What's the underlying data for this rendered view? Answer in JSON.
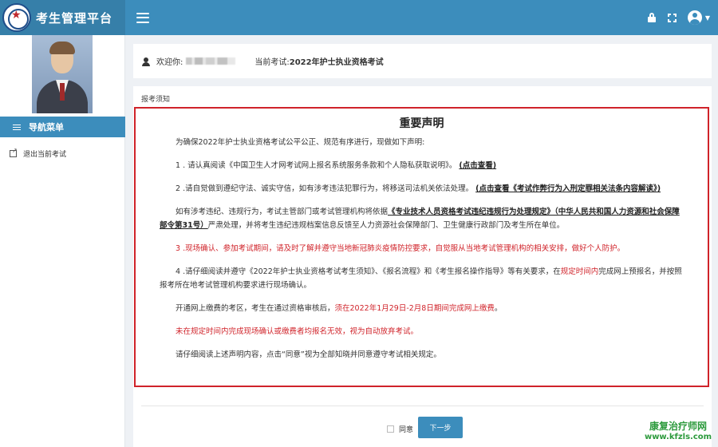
{
  "header": {
    "title": "考生管理平台"
  },
  "sidebar": {
    "menu_title": "导航菜单",
    "items": [
      {
        "label": "退出当前考试"
      }
    ]
  },
  "welcome": {
    "greeting": "欢迎你:",
    "current_exam_label": "当前考试:",
    "current_exam": "2022年护士执业资格考试"
  },
  "panel": {
    "label": "报考须知"
  },
  "notice": {
    "title": "重要声明",
    "intro": "为确保2022年护士执业资格考试公平公正、规范有序进行，现做如下声明:",
    "p1_text": "1 . 请认真阅读《中国卫生人才网考试网上报名系统服务条款和个人隐私获取说明》。",
    "p1_link": "(点击查看)",
    "p2_text": "2 .请自觉做到遵纪守法、诚实守信，如有涉考违法犯罪行为，将移送司法机关依法处理。",
    "p2_link": "(点击查看《考试作弊行为入刑定罪相关法条内容解读》)",
    "p3_text_a": "如有涉考违纪、违规行为，考试主管部门或考试管理机构将依据",
    "p3_link": "《专业技术人员资格考试违纪违规行为处理规定》（中华人民共和国人力资源和社会保障部令第31号）",
    "p3_text_b": "严肃处理，并将考生违纪违规档案信息反馈至人力资源社会保障部门、卫生健康行政部门及考生所在单位。",
    "p4_red": "3 .现场确认、参加考试期间，请及时了解并遵守当地新冠肺炎疫情防控要求，自觉服从当地考试管理机构的相关安排，做好个人防护。",
    "p5_text_a": "4 .请仔细阅读并遵守《2022年护士执业资格考试考生须知》、《报名流程》和《考生报名操作指导》等有关要求，在",
    "p5_red": "规定时间内",
    "p5_text_b": "完成网上预报名，并按照报考所在地考试管理机构要求进行现场确认。",
    "p6_text": "开通网上缴费的考区，考生在通过资格审核后，",
    "p6_red": "须在2022年1月29日-2月8日期间完成网上缴费",
    "p6_end": "。",
    "p7_red": "未在规定时间内完成现场确认或缴费者均报名无效，视为自动放弃考试。",
    "p8_text": "请仔细阅读上述声明内容，点击“同意”视为全部知晓并同意遵守考试相关规定。"
  },
  "footer": {
    "agree_label": "同意",
    "next_label": "下一步"
  },
  "watermark": {
    "line1": "康复治疗师网",
    "line2": "www.kfzls.com"
  },
  "colors": {
    "primary": "#3c8dbc",
    "brand_dark": "#367fa9",
    "notice_border": "#d0232a",
    "watermark": "#2c9a3c"
  },
  "icons": {
    "menu": "hamburger-icon",
    "lock": "lock-icon",
    "fullscreen": "fullscreen-icon",
    "user": "user-avatar-icon",
    "exit": "external-link-icon"
  }
}
